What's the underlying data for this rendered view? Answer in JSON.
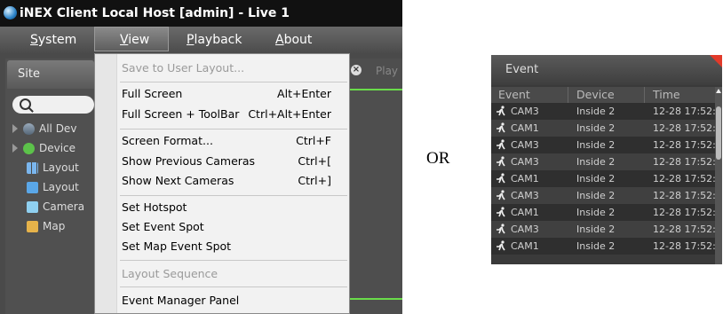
{
  "window": {
    "title": "iNEX Client Local Host [admin] - Live  1"
  },
  "menubar": {
    "items": [
      "System",
      "View",
      "Playback",
      "About"
    ],
    "active": "View"
  },
  "site_panel": {
    "tab_label": "Site",
    "tree": [
      {
        "label": "All Dev",
        "icon": "devices-icon"
      },
      {
        "label": "Device",
        "icon": "device-icon"
      },
      {
        "label": "Layout",
        "icon": "layout-grid-icon"
      },
      {
        "label": "Layout",
        "icon": "layout-folder-icon"
      },
      {
        "label": "Camera",
        "icon": "camera-icon"
      },
      {
        "label": "Map",
        "icon": "map-icon"
      }
    ]
  },
  "play_tab": {
    "label": "Play"
  },
  "view_menu": {
    "items": [
      {
        "label": "Save to User Layout...",
        "shortcut": "",
        "disabled": true
      },
      {
        "label": "Full Screen",
        "shortcut": "Alt+Enter",
        "disabled": false
      },
      {
        "label": "Full Screen + ToolBar",
        "shortcut": "Ctrl+Alt+Enter",
        "disabled": false
      },
      {
        "label": "Screen Format...",
        "shortcut": "Ctrl+F",
        "disabled": false
      },
      {
        "label": "Show Previous Cameras",
        "shortcut": "Ctrl+[",
        "disabled": false
      },
      {
        "label": "Show Next Cameras",
        "shortcut": "Ctrl+]",
        "disabled": false
      },
      {
        "label": "Set Hotspot",
        "shortcut": "",
        "disabled": false
      },
      {
        "label": "Set Event Spot",
        "shortcut": "",
        "disabled": false
      },
      {
        "label": "Set Map Event Spot",
        "shortcut": "",
        "disabled": false
      },
      {
        "label": "Layout Sequence",
        "shortcut": "",
        "disabled": true
      },
      {
        "label": "Event Manager Panel",
        "shortcut": "",
        "disabled": false
      }
    ]
  },
  "or_text": "OR",
  "event_panel": {
    "title": "Event",
    "columns": [
      "Event",
      "Device",
      "Time"
    ],
    "rows": [
      {
        "event": "CAM3",
        "device": "Inside 2",
        "time": "12-28 17:52:"
      },
      {
        "event": "CAM1",
        "device": "Inside 2",
        "time": "12-28 17:52:"
      },
      {
        "event": "CAM3",
        "device": "Inside 2",
        "time": "12-28 17:52:"
      },
      {
        "event": "CAM3",
        "device": "Inside 2",
        "time": "12-28 17:52:"
      },
      {
        "event": "CAM1",
        "device": "Inside 2",
        "time": "12-28 17:52:"
      },
      {
        "event": "CAM3",
        "device": "Inside 2",
        "time": "12-28 17:52:"
      },
      {
        "event": "CAM1",
        "device": "Inside 2",
        "time": "12-28 17:52:"
      },
      {
        "event": "CAM3",
        "device": "Inside 2",
        "time": "12-28 17:52:"
      },
      {
        "event": "CAM1",
        "device": "Inside 2",
        "time": "12-28 17:52:"
      }
    ]
  },
  "colors": {
    "accent_green": "#6adc4a",
    "corner_red": "#e23a2a"
  }
}
